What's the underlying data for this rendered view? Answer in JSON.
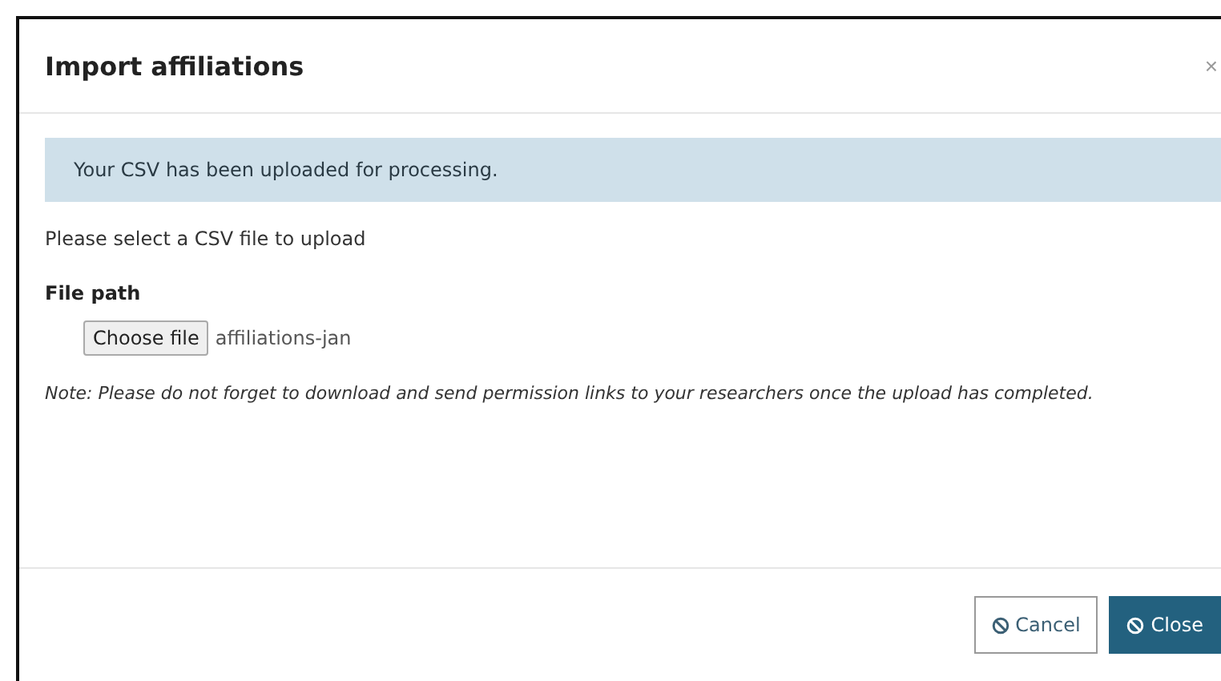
{
  "dialog": {
    "title": "Import affiliations",
    "close": "×"
  },
  "alert": "Your CSV has been uploaded for processing.",
  "instruction": "Please select a CSV file to upload",
  "file_field": {
    "label": "File path",
    "button": "Choose file",
    "value": "affiliations-jan"
  },
  "note": "Note: Please do not forget to download and send permission links to your researchers once the upload has completed.",
  "buttons": [
    {
      "label": "Cancel",
      "kind": "secondary"
    },
    {
      "label": "Close",
      "kind": "primary"
    }
  ]
}
